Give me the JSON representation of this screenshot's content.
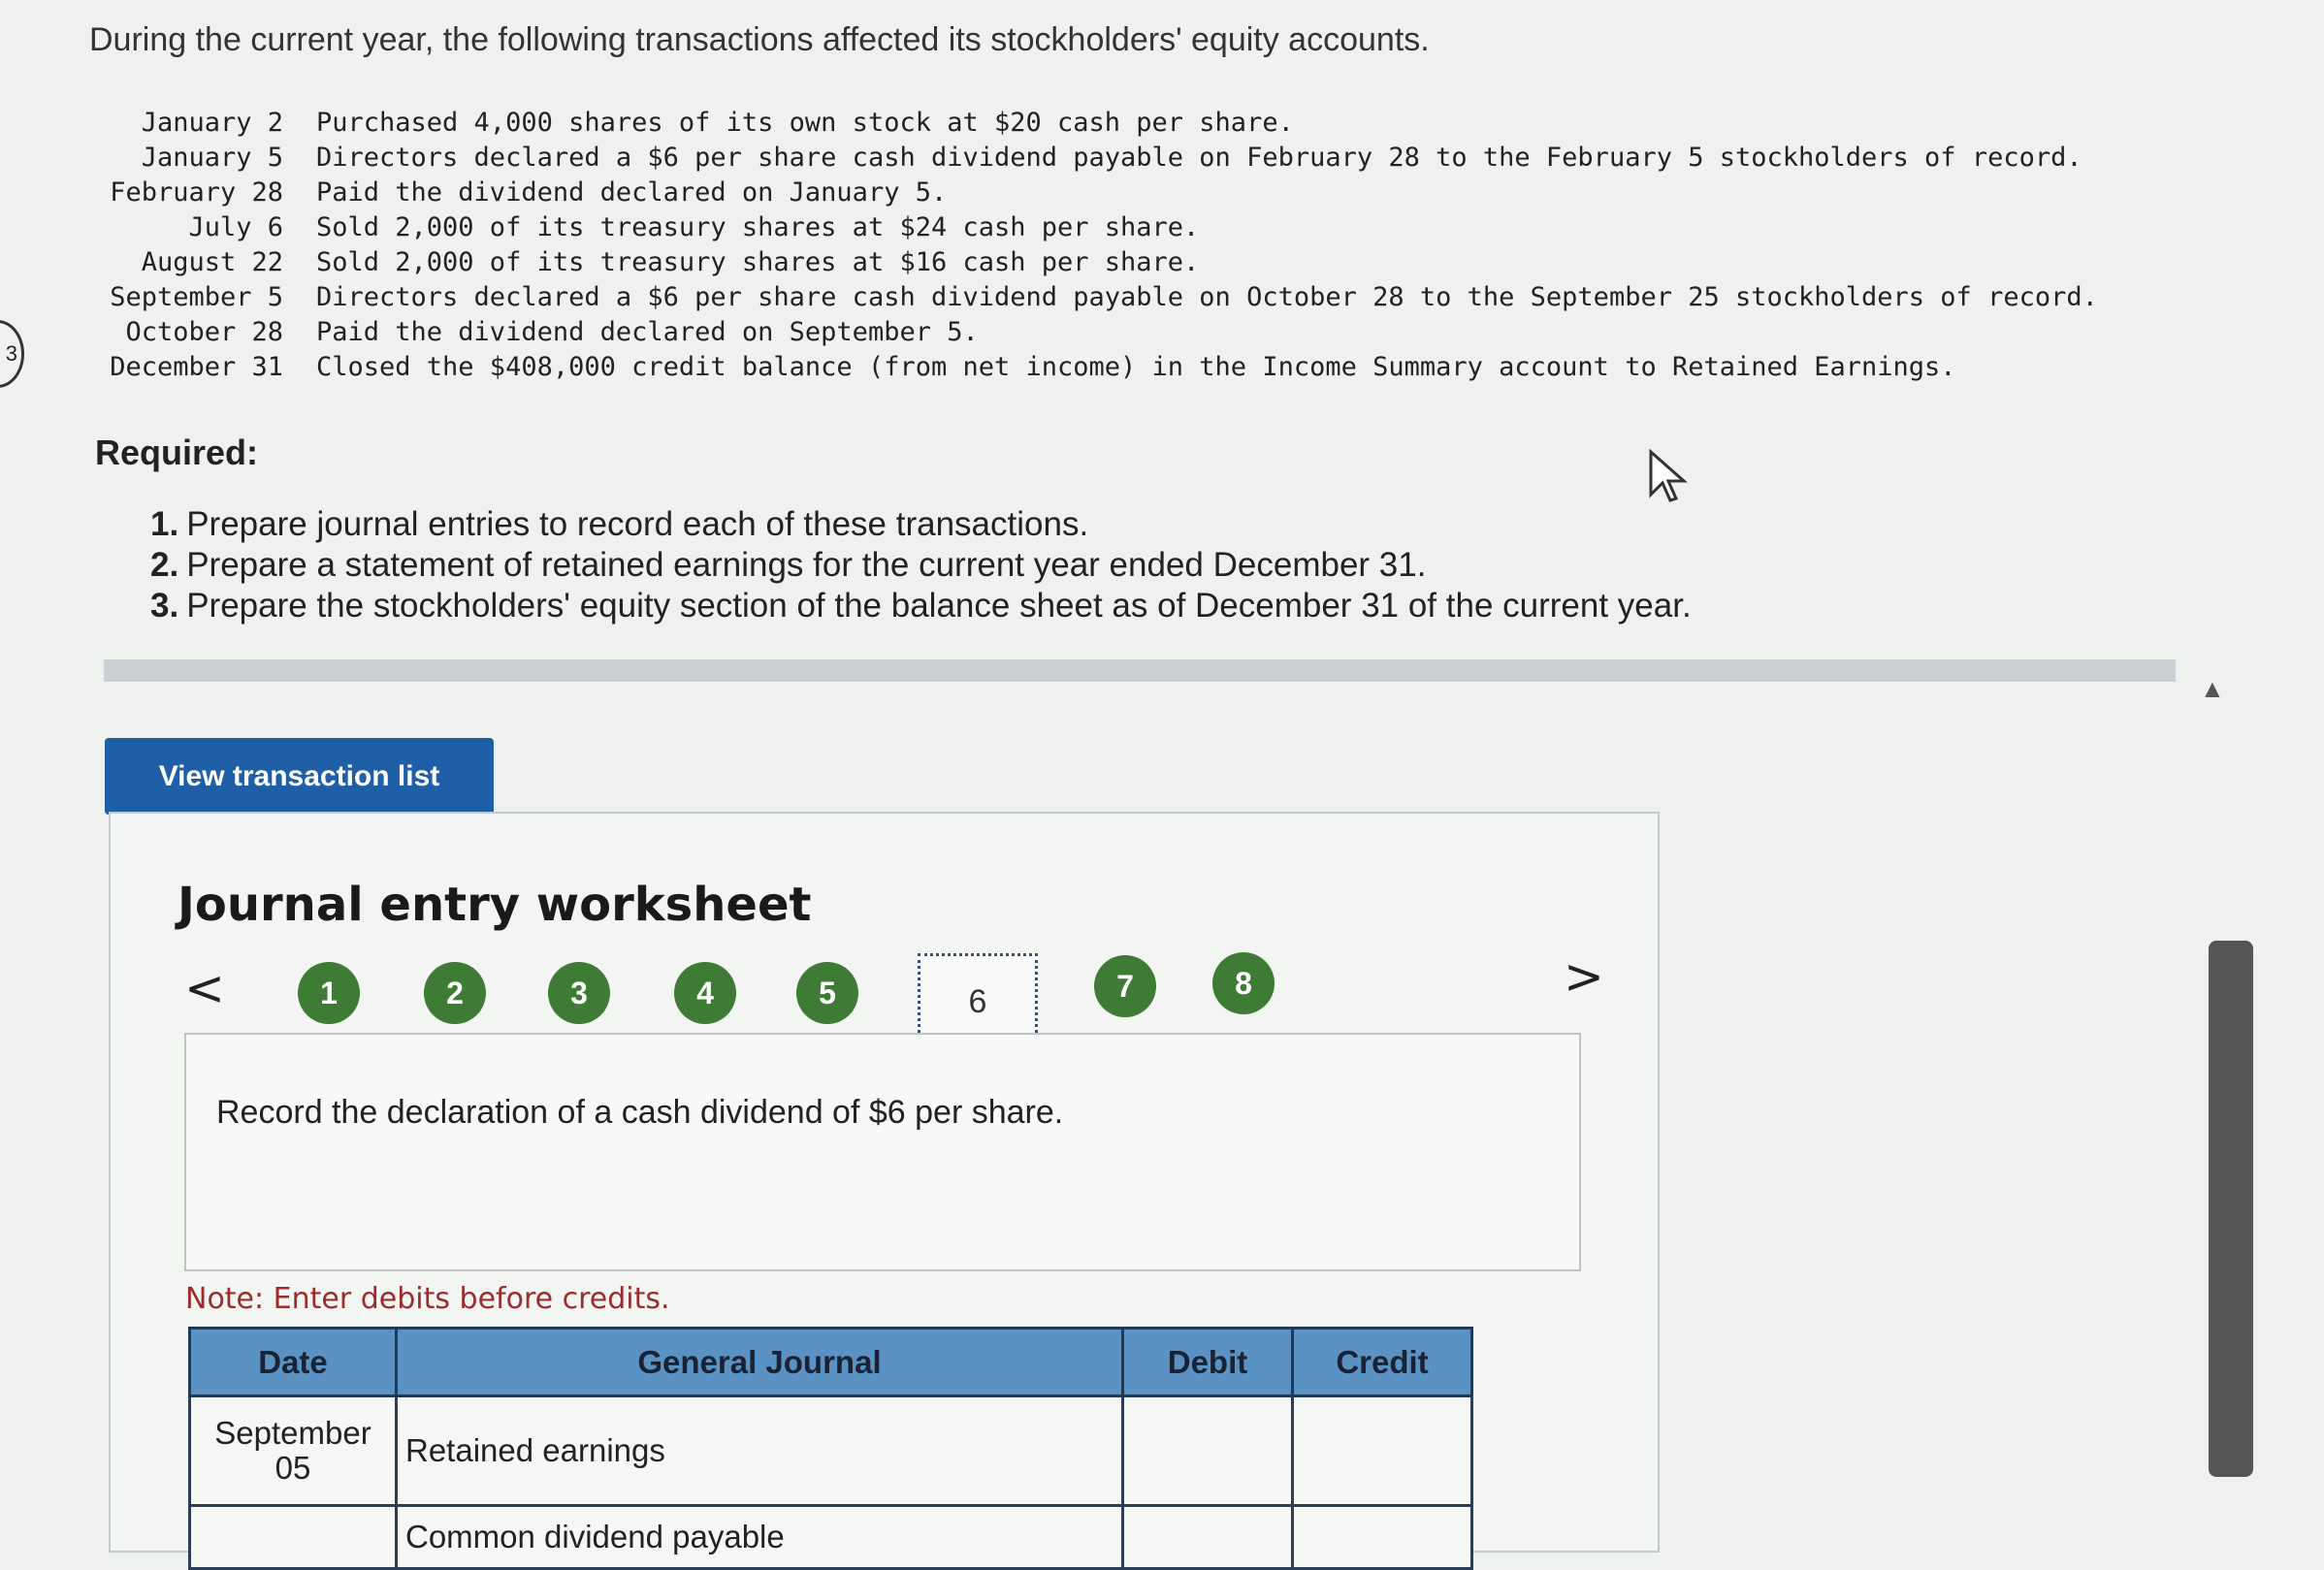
{
  "intro": "During the current year, the following transactions affected its stockholders' equity accounts.",
  "transactions": [
    {
      "date": "January 2",
      "description": "Purchased 4,000 shares of its own stock at $20 cash per share."
    },
    {
      "date": "January 5",
      "description": "Directors declared a $6 per share cash dividend payable on February 28 to the February 5 stockholders of record."
    },
    {
      "date": "February 28",
      "description": "Paid the dividend declared on January 5."
    },
    {
      "date": "July 6",
      "description": "Sold 2,000 of its treasury shares at $24 cash per share."
    },
    {
      "date": "August 22",
      "description": "Sold 2,000 of its treasury shares at $16 cash per share."
    },
    {
      "date": "September 5",
      "description": "Directors declared a $6 per share cash dividend payable on October 28 to the September 25 stockholders of record."
    },
    {
      "date": "October 28",
      "description": "Paid the dividend declared on September 5."
    },
    {
      "date": "December 31",
      "description": "Closed the $408,000 credit balance (from net income) in the Income Summary account to Retained Earnings."
    }
  ],
  "required": {
    "label": "Required:",
    "items": [
      {
        "num": "1.",
        "text": "Prepare journal entries to record each of these transactions."
      },
      {
        "num": "2.",
        "text": "Prepare a statement of retained earnings for the current year ended December 31."
      },
      {
        "num": "3.",
        "text": "Prepare the stockholders' equity section of the balance sheet as of December 31 of the current year."
      }
    ]
  },
  "view_button": "View transaction list",
  "worksheet": {
    "title": "Journal entry worksheet",
    "prev": "<",
    "next": ">",
    "steps": [
      "1",
      "2",
      "3",
      "4",
      "5",
      "6",
      "7",
      "8"
    ],
    "current_step": "6",
    "instruction": "Record the declaration of a cash dividend of $6 per share.",
    "note": "Note: Enter debits before credits.",
    "table": {
      "headers": {
        "date": "Date",
        "journal": "General Journal",
        "debit": "Debit",
        "credit": "Credit"
      },
      "rows": [
        {
          "date_line1": "September",
          "date_line2": "05",
          "account": "Retained earnings",
          "debit": "",
          "credit": ""
        },
        {
          "date_line1": "",
          "date_line2": "",
          "account": "Common dividend payable",
          "debit": "",
          "credit": ""
        }
      ]
    }
  },
  "colors": {
    "button": "#1f5fa8",
    "step_circle": "#3e7b35",
    "table_header": "#5b92c4",
    "note": "#9c2b2b"
  }
}
